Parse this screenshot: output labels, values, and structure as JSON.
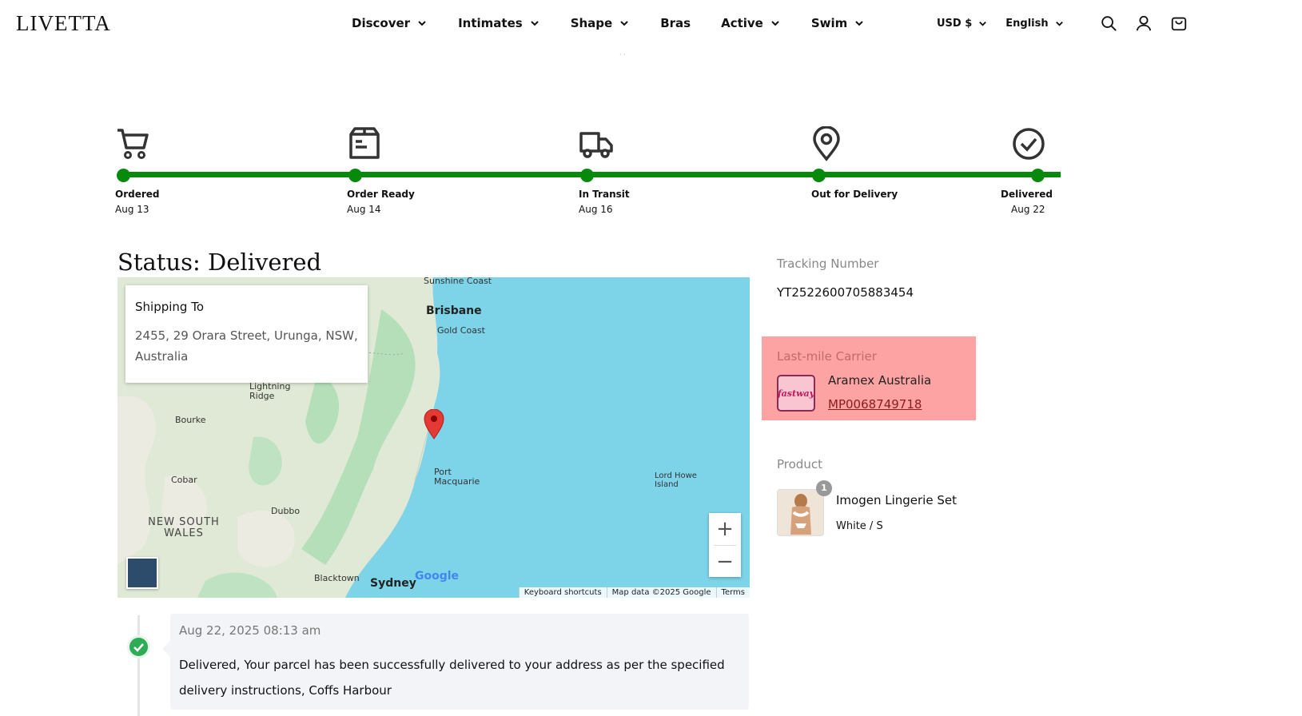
{
  "header": {
    "logo": "LIVETTA",
    "nav": [
      "Discover",
      "Intimates",
      "Shape",
      "Bras",
      "Active",
      "Swim"
    ],
    "nav_has_dropdown": [
      true,
      true,
      true,
      false,
      true,
      true
    ],
    "currency": "USD $",
    "language": "English",
    "icons": [
      "search-icon",
      "account-icon",
      "cart-icon"
    ]
  },
  "timeline": {
    "steps": [
      {
        "label": "Ordered",
        "date": "Aug 13",
        "icon": "cart-icon"
      },
      {
        "label": "Order Ready",
        "date": "Aug 14",
        "icon": "package-icon"
      },
      {
        "label": "In Transit",
        "date": "Aug 16",
        "icon": "truck-icon"
      },
      {
        "label": "Out for Delivery",
        "date": "",
        "icon": "map-pin-icon"
      },
      {
        "label": "Delivered",
        "date": "Aug 22",
        "icon": "check-circle-icon"
      }
    ],
    "progress_color": "#078a0c",
    "completed_steps": 5
  },
  "status": {
    "title": "Status: Delivered"
  },
  "map": {
    "shipping_to_label": "Shipping To",
    "address": "2455, 29 Orara Street, Urunga, NSW, Australia",
    "labels": {
      "sunshine_coast": "Sunshine Coast",
      "brisbane": "Brisbane",
      "gold_coast": "Gold Coast",
      "lightning_ridge": "Lightning Ridge",
      "bourke": "Bourke",
      "cobar": "Cobar",
      "dubbo": "Dubbo",
      "port_macquarie": "Port Macquarie",
      "lord_howe": "Lord Howe Island",
      "nsw": "NEW SOUTH WALES",
      "blacktown": "Blacktown",
      "sydney": "Sydney"
    },
    "footer": [
      "Keyboard shortcuts",
      "Map data ©2025 Google",
      "Terms"
    ],
    "google": "Google",
    "zoom_in": "+",
    "zoom_out": "−"
  },
  "event": {
    "time": "Aug 22, 2025 08:13 am",
    "text": "Delivered, Your parcel has been successfully delivered to your address as per the specified delivery instructions, Coffs Harbour"
  },
  "sidebar": {
    "tracking_label": "Tracking Number",
    "tracking_number": "YT2522600705883454",
    "carrier_label": "Last-mile Carrier",
    "carrier_name": "Aramex Australia",
    "carrier_number": "MP0068749718",
    "carrier_logo_text": "fastway",
    "product_label": "Product",
    "product_qty": "1",
    "product_name": "Imogen Lingerie Set",
    "product_variant": "White / S"
  }
}
